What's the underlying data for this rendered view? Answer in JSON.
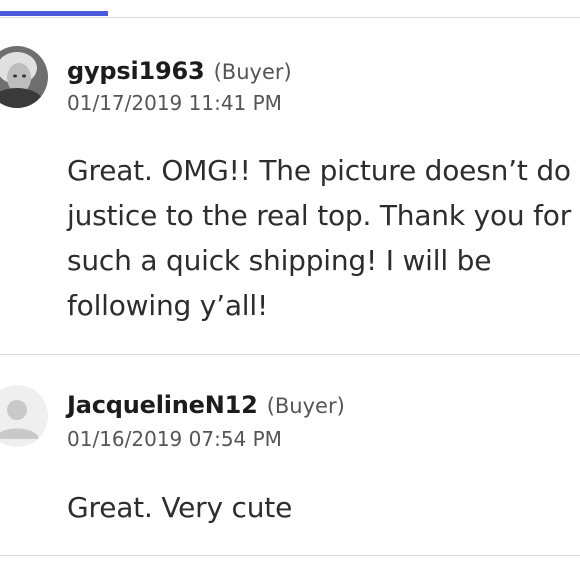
{
  "reviews": [
    {
      "username": "gypsi1963",
      "role": "(Buyer)",
      "date": "01/17/2019 11:41 PM",
      "text": "Great. OMG!! The picture doesn’t do justice to the real top. Thank you for such a quick shipping! I will be following y’all!"
    },
    {
      "username": "JacquelineN12",
      "role": "(Buyer)",
      "date": "01/16/2019 07:54 PM",
      "text": "Great. Very cute"
    }
  ],
  "colors": {
    "accent": "#4b5bdc",
    "divider": "#d6d6d6",
    "text": "#2d2d2d",
    "muted": "#555555"
  }
}
